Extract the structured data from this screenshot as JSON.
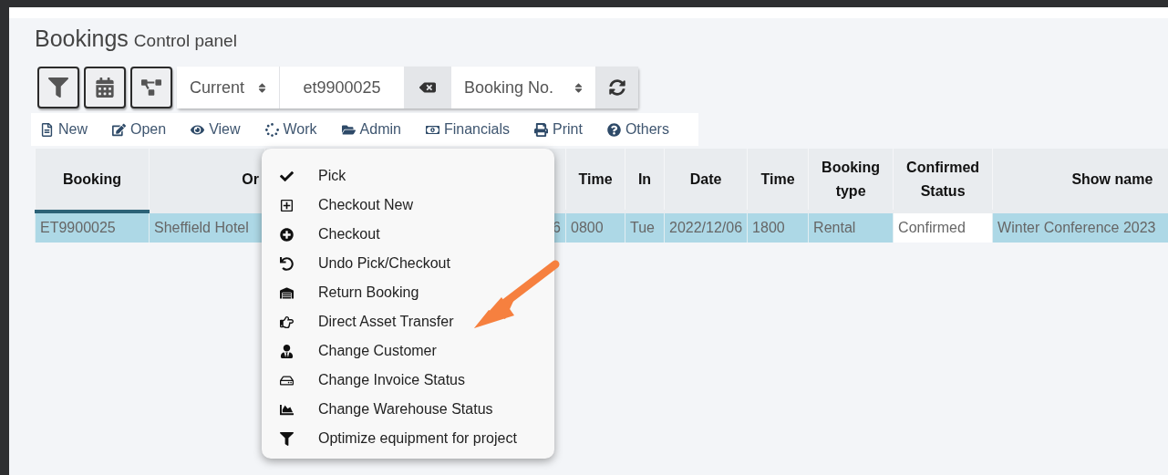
{
  "header": {
    "title": "Bookings",
    "subtitle": "Control panel"
  },
  "toolbar": {
    "status_select": "Current",
    "search": {
      "value": "et9900025"
    },
    "field_select": "Booking No."
  },
  "menu_bar": [
    {
      "label": "New"
    },
    {
      "label": "Open"
    },
    {
      "label": "View"
    },
    {
      "label": "Work"
    },
    {
      "label": "Admin"
    },
    {
      "label": "Financials"
    },
    {
      "label": "Print"
    },
    {
      "label": "Others"
    }
  ],
  "table": {
    "columns": [
      {
        "label": "Booking",
        "sorted": true
      },
      {
        "label": "Or",
        "sorted": false
      },
      {
        "sorted": false
      },
      {
        "label": "Time",
        "sorted": false
      },
      {
        "label": "In",
        "sorted": false
      },
      {
        "label": "Date",
        "sorted": false
      },
      {
        "label": "Time",
        "sorted": false
      },
      {
        "label": "Booking type",
        "sorted": false
      },
      {
        "label": "Confirmed Status",
        "sorted": false
      },
      {
        "label": "Show name",
        "sorted": false
      }
    ],
    "rows": [
      {
        "selected": true,
        "cells": [
          {
            "text": "ET9900025",
            "focused": false
          },
          {
            "text": "Sheffield Hotel",
            "focused": false
          },
          {
            "text": "6",
            "focused": false
          },
          {
            "text": "0800",
            "focused": false
          },
          {
            "text": "Tue",
            "focused": false
          },
          {
            "text": "2022/12/06",
            "focused": false
          },
          {
            "text": "1800",
            "focused": false
          },
          {
            "text": "Rental",
            "focused": false
          },
          {
            "text": "Confirmed",
            "focused": true
          },
          {
            "text": "Winter Conference 2023",
            "focused": false
          }
        ]
      }
    ]
  },
  "work_menu": {
    "items": [
      {
        "label": "Pick"
      },
      {
        "label": "Checkout New"
      },
      {
        "label": "Checkout"
      },
      {
        "label": "Undo Pick/Checkout"
      },
      {
        "label": "Return Booking"
      },
      {
        "label": "Direct Asset Transfer"
      },
      {
        "label": "Change Customer"
      },
      {
        "label": "Change Invoice Status"
      },
      {
        "label": "Change Warehouse Status"
      },
      {
        "label": "Optimize equipment for project"
      }
    ]
  }
}
